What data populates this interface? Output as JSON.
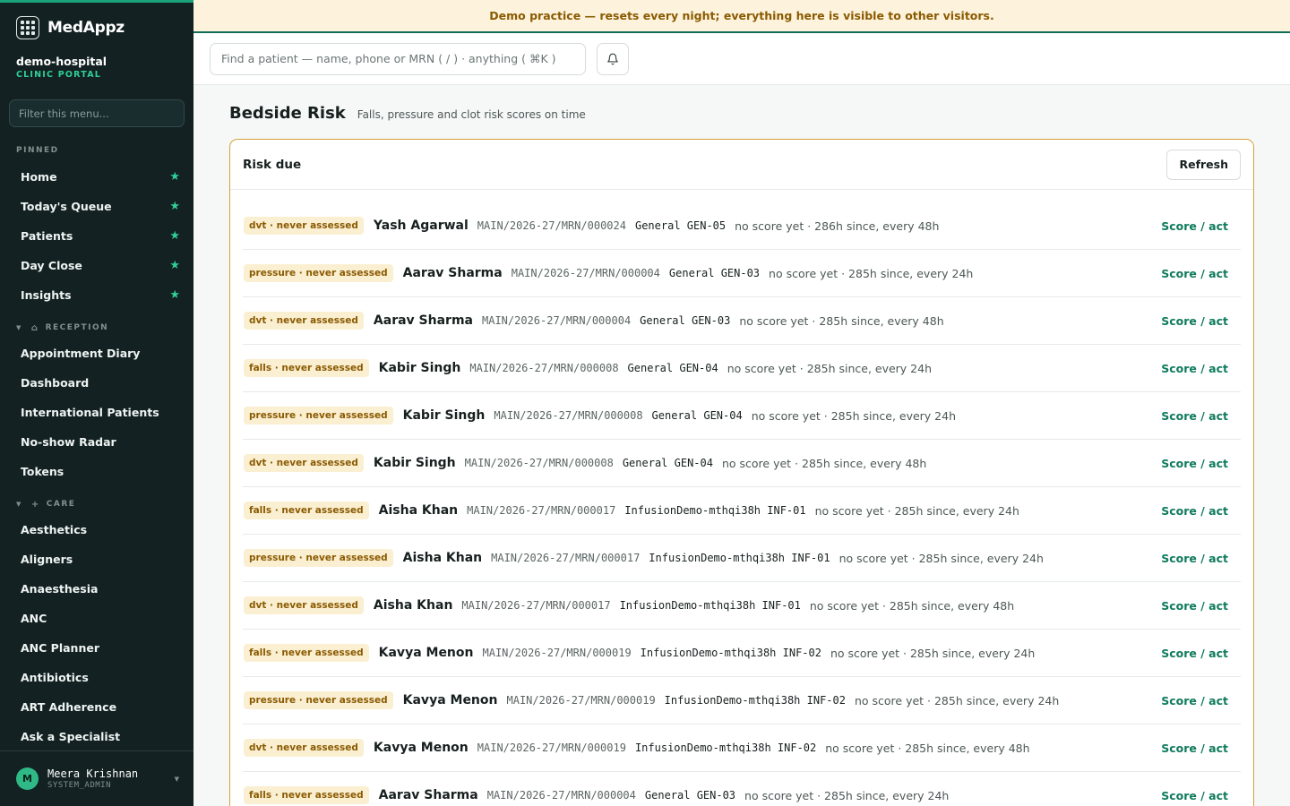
{
  "brand": {
    "name": "MedAppz"
  },
  "org": {
    "name": "demo-hospital",
    "subtitle": "CLINIC PORTAL"
  },
  "sidebar": {
    "filter_placeholder": "Filter this menu...",
    "pinned_label": "PINNED",
    "pinned": [
      {
        "label": "Home"
      },
      {
        "label": "Today's Queue"
      },
      {
        "label": "Patients"
      },
      {
        "label": "Day Close"
      },
      {
        "label": "Insights"
      }
    ],
    "groups": [
      {
        "label": "RECEPTION",
        "icon": "home-icon",
        "items": [
          {
            "label": "Appointment Diary"
          },
          {
            "label": "Dashboard"
          },
          {
            "label": "International Patients"
          },
          {
            "label": "No-show Radar"
          },
          {
            "label": "Tokens"
          }
        ]
      },
      {
        "label": "CARE",
        "icon": "plus-icon",
        "items": [
          {
            "label": "Aesthetics"
          },
          {
            "label": "Aligners"
          },
          {
            "label": "Anaesthesia"
          },
          {
            "label": "ANC"
          },
          {
            "label": "ANC Planner"
          },
          {
            "label": "Antibiotics"
          },
          {
            "label": "ART Adherence"
          },
          {
            "label": "Ask a Specialist"
          }
        ]
      }
    ],
    "user": {
      "initial": "M",
      "name": "Meera Krishnan",
      "role": "SYSTEM_ADMIN"
    }
  },
  "banner": {
    "text": "Demo practice — resets every night; everything here is visible to other visitors."
  },
  "topbar": {
    "search_placeholder": "Find a patient — name, phone or MRN ( / ) · anything ( ⌘K )"
  },
  "page": {
    "title": "Bedside Risk",
    "subtitle": "Falls, pressure and clot risk scores on time"
  },
  "card": {
    "title": "Risk due",
    "refresh_label": "Refresh",
    "action_label": "Score / act",
    "rows": [
      {
        "badge": "dvt · never assessed",
        "name": "Yash Agarwal",
        "mrn": "MAIN/2026-27/MRN/000024",
        "ward": "General GEN-05",
        "status": "no score yet · 286h since, every 48h"
      },
      {
        "badge": "pressure · never assessed",
        "name": "Aarav Sharma",
        "mrn": "MAIN/2026-27/MRN/000004",
        "ward": "General GEN-03",
        "status": "no score yet · 285h since, every 24h"
      },
      {
        "badge": "dvt · never assessed",
        "name": "Aarav Sharma",
        "mrn": "MAIN/2026-27/MRN/000004",
        "ward": "General GEN-03",
        "status": "no score yet · 285h since, every 48h"
      },
      {
        "badge": "falls · never assessed",
        "name": "Kabir Singh",
        "mrn": "MAIN/2026-27/MRN/000008",
        "ward": "General GEN-04",
        "status": "no score yet · 285h since, every 24h"
      },
      {
        "badge": "pressure · never assessed",
        "name": "Kabir Singh",
        "mrn": "MAIN/2026-27/MRN/000008",
        "ward": "General GEN-04",
        "status": "no score yet · 285h since, every 24h"
      },
      {
        "badge": "dvt · never assessed",
        "name": "Kabir Singh",
        "mrn": "MAIN/2026-27/MRN/000008",
        "ward": "General GEN-04",
        "status": "no score yet · 285h since, every 48h"
      },
      {
        "badge": "falls · never assessed",
        "name": "Aisha Khan",
        "mrn": "MAIN/2026-27/MRN/000017",
        "ward": "InfusionDemo-mthqi38h INF-01",
        "status": "no score yet · 285h since, every 24h"
      },
      {
        "badge": "pressure · never assessed",
        "name": "Aisha Khan",
        "mrn": "MAIN/2026-27/MRN/000017",
        "ward": "InfusionDemo-mthqi38h INF-01",
        "status": "no score yet · 285h since, every 24h"
      },
      {
        "badge": "dvt · never assessed",
        "name": "Aisha Khan",
        "mrn": "MAIN/2026-27/MRN/000017",
        "ward": "InfusionDemo-mthqi38h INF-01",
        "status": "no score yet · 285h since, every 48h"
      },
      {
        "badge": "falls · never assessed",
        "name": "Kavya Menon",
        "mrn": "MAIN/2026-27/MRN/000019",
        "ward": "InfusionDemo-mthqi38h INF-02",
        "status": "no score yet · 285h since, every 24h"
      },
      {
        "badge": "pressure · never assessed",
        "name": "Kavya Menon",
        "mrn": "MAIN/2026-27/MRN/000019",
        "ward": "InfusionDemo-mthqi38h INF-02",
        "status": "no score yet · 285h since, every 24h"
      },
      {
        "badge": "dvt · never assessed",
        "name": "Kavya Menon",
        "mrn": "MAIN/2026-27/MRN/000019",
        "ward": "InfusionDemo-mthqi38h INF-02",
        "status": "no score yet · 285h since, every 48h"
      },
      {
        "badge": "falls · never assessed",
        "name": "Aarav Sharma",
        "mrn": "MAIN/2026-27/MRN/000004",
        "ward": "General GEN-03",
        "status": "no score yet · 285h since, every 24h"
      }
    ]
  }
}
